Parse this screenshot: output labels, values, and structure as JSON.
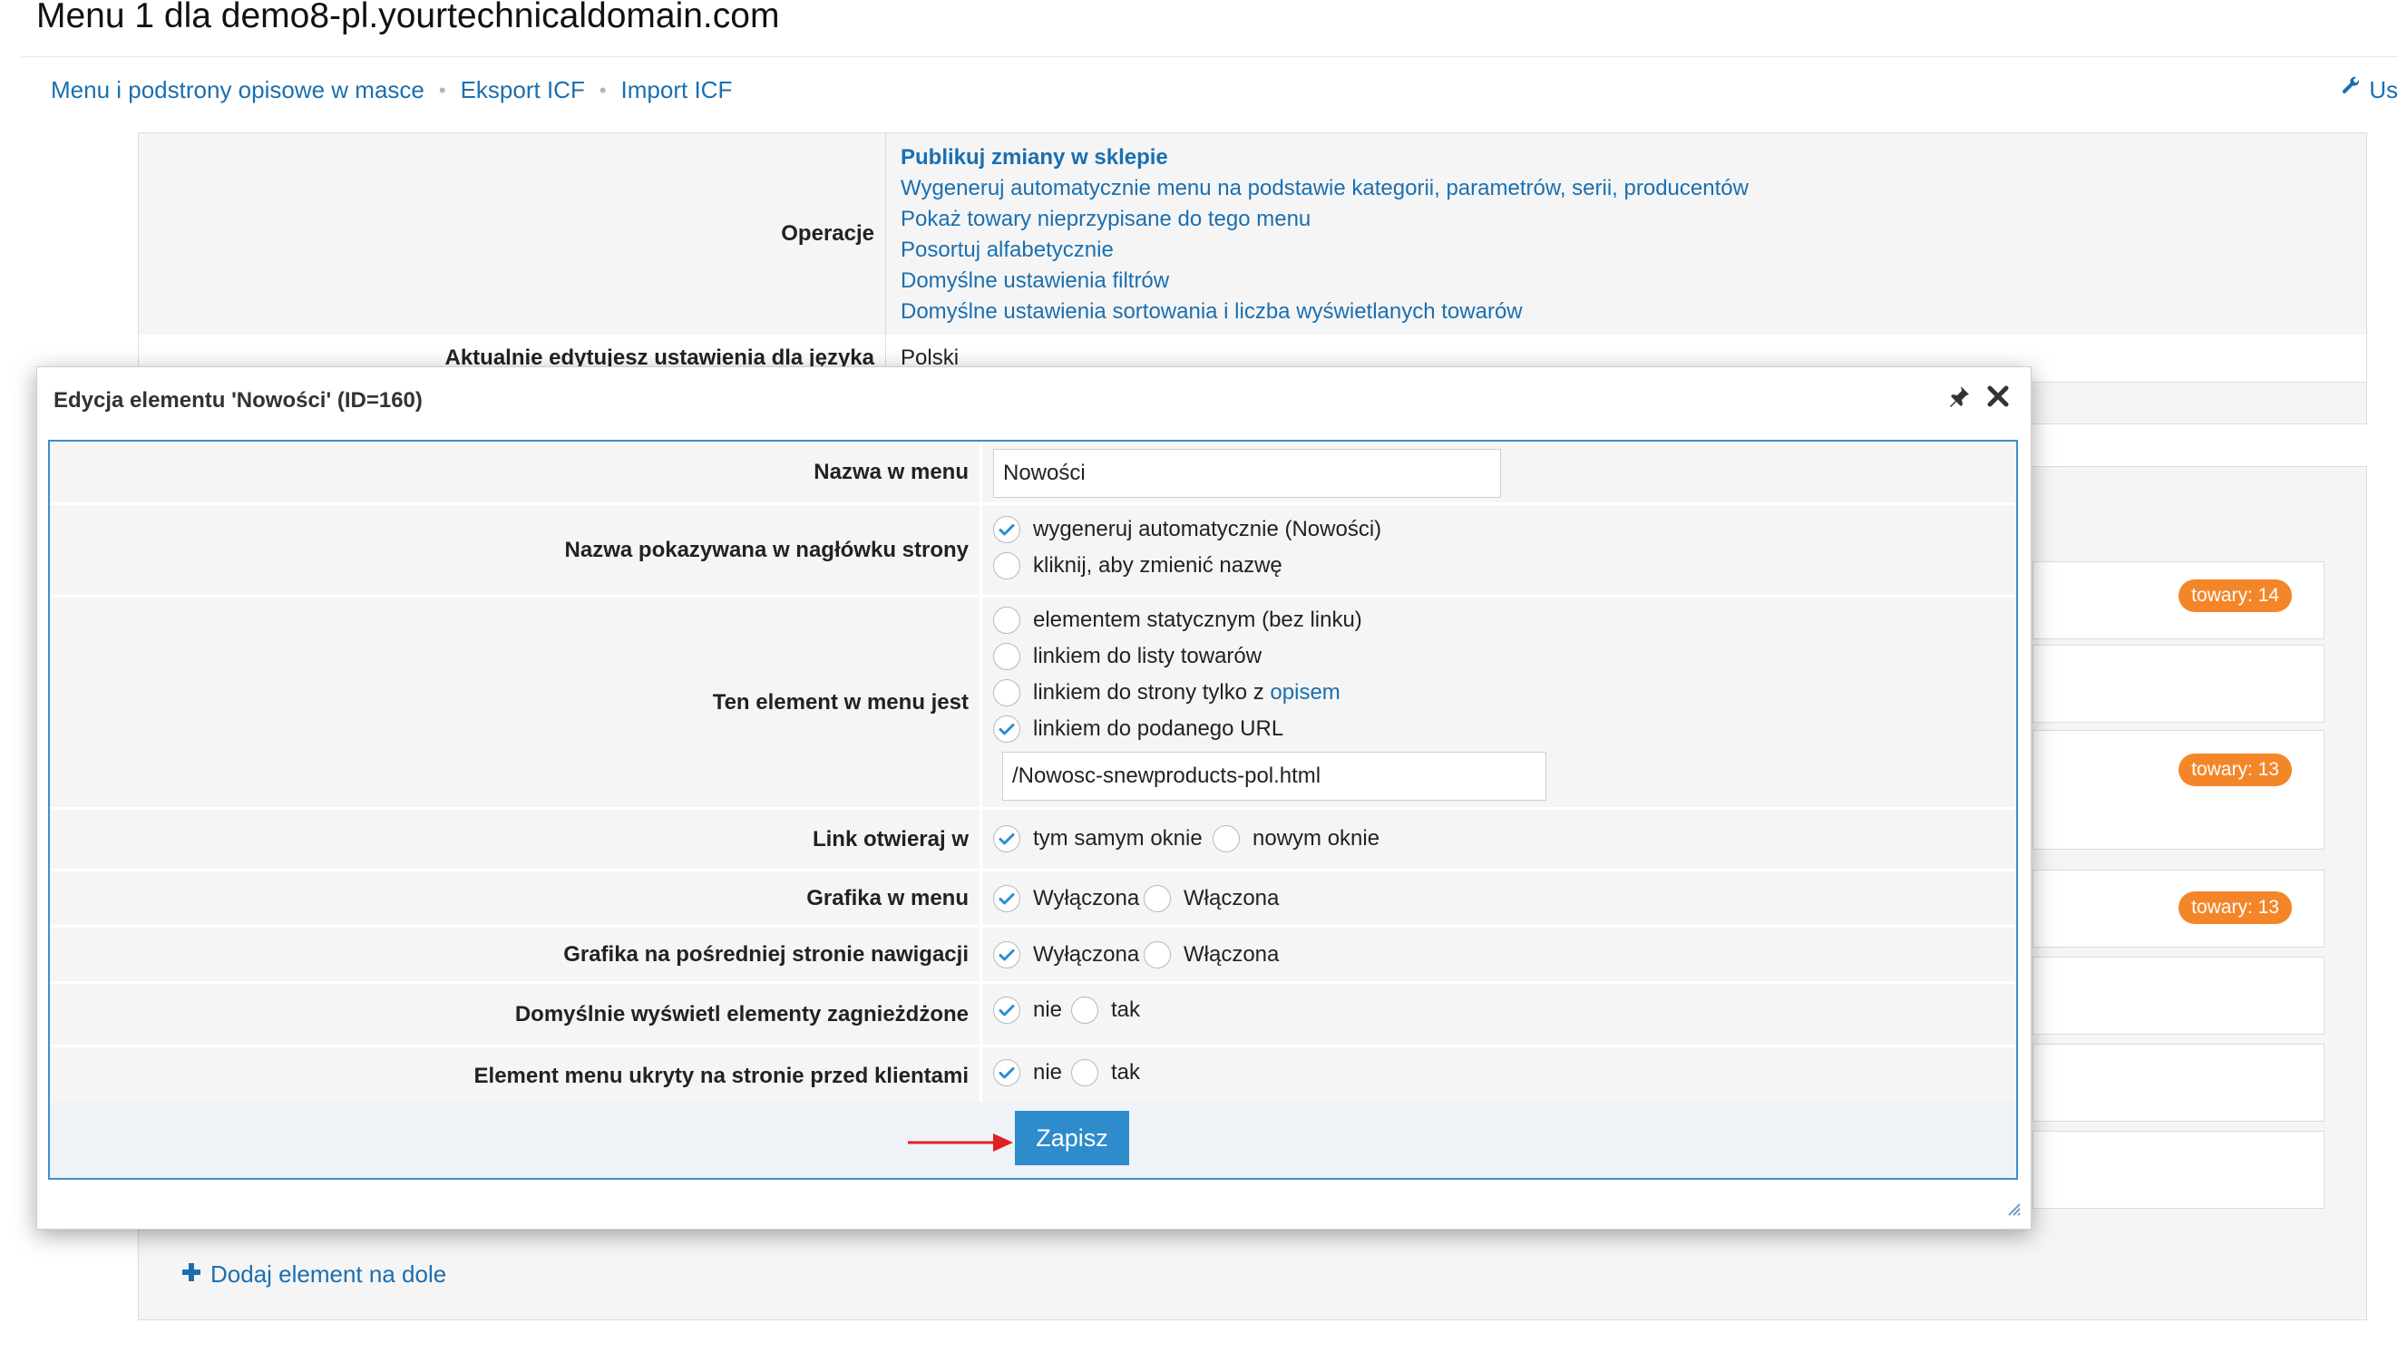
{
  "page": {
    "title": "Menu 1 dla demo8-pl.yourtechnicaldomain.com",
    "nav": [
      "Menu i podstrony opisowe w masce",
      "Eksport ICF",
      "Import ICF"
    ],
    "top_right_label": "Us",
    "icons": {
      "top_right": "wrench-icon",
      "add": "plus-icon",
      "pin": "pin-icon",
      "close": "close-icon"
    }
  },
  "background": {
    "operations_label": "Operacje",
    "operations": [
      "Publikuj zmiany w sklepie",
      "Wygeneruj automatycznie menu na podstawie kategorii, parametrów, serii, producentów",
      "Pokaż towary nieprzypisane do tego menu",
      "Posortuj alfabetycznie",
      "Domyślne ustawienia filtrów",
      "Domyślne ustawienia sortowania i liczba wyświetlanych towarów"
    ],
    "language_label": "Aktualnie edytujesz ustawienia dla języka",
    "language_value": "Polski",
    "badges": [
      "towary: 14",
      "towary: 13",
      "towary: 13"
    ],
    "add_bottom": "Dodaj element na dole"
  },
  "dialog": {
    "title": "Edycja elementu 'Nowości' (ID=160)",
    "rows": {
      "name": {
        "label": "Nazwa w menu",
        "value": "Nowości"
      },
      "header_name": {
        "label": "Nazwa pokazywana w nagłówku strony",
        "options": [
          "wygeneruj automatycznie (Nowości)",
          "kliknij, aby zmienić nazwę"
        ],
        "selected": 0
      },
      "element_type": {
        "label": "Ten element w menu jest",
        "options": [
          "elementem statycznym (bez linku)",
          "linkiem do listy towarów",
          "linkiem do strony tylko z ",
          "linkiem do podanego URL"
        ],
        "option3_link": "opisem",
        "selected": 3,
        "url_value": "/Nowosc-snewproducts-pol.html"
      },
      "link_open": {
        "label": "Link otwieraj w",
        "options": [
          "tym samym oknie",
          "nowym oknie"
        ],
        "selected": 0
      },
      "menu_graphic": {
        "label": "Grafika w menu",
        "options": [
          "Wyłączona",
          "Włączona"
        ],
        "selected": 0
      },
      "nav_graphic": {
        "label": "Grafika na pośredniej stronie nawigacji",
        "options": [
          "Wyłączona",
          "Włączona"
        ],
        "selected": 0
      },
      "nested_default": {
        "label": "Domyślnie wyświetl elementy zagnieżdżone",
        "options": [
          "nie",
          "tak"
        ],
        "selected": 0
      },
      "hidden": {
        "label": "Element menu ukryty na stronie przed klientami",
        "options": [
          "nie",
          "tak"
        ],
        "selected": 0
      }
    },
    "save_label": "Zapisz"
  },
  "colors": {
    "link": "#1a6fb0",
    "accent_border": "#3b8fd0",
    "button": "#2e8bcc",
    "badge": "#f4862a",
    "check": "#2a8fcf",
    "arrow": "#e02020"
  }
}
